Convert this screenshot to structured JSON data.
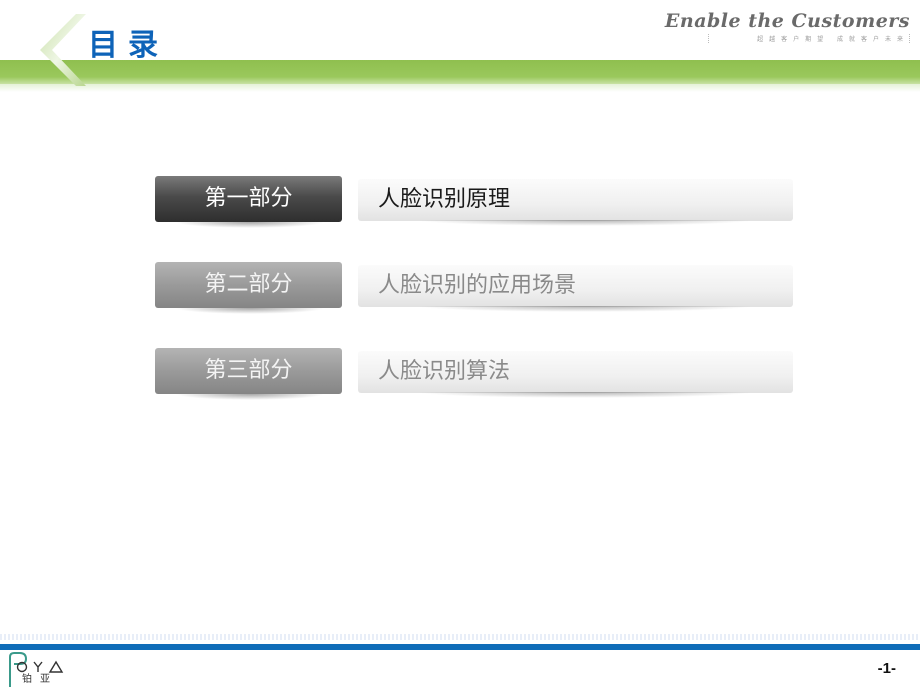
{
  "header": {
    "title": "目录",
    "slogan": "Enable the Customers",
    "slogan_sub": "超越客户期望 成就客户未来"
  },
  "contents": [
    {
      "part": "第一部分",
      "topic": "人脸识别原理",
      "active": true
    },
    {
      "part": "第二部分",
      "topic": "人脸识别的应用场景",
      "active": false
    },
    {
      "part": "第三部分",
      "topic": "人脸识别算法",
      "active": false
    }
  ],
  "footer": {
    "logo_text": "OYA",
    "logo_sub": "铂亚",
    "page_number": "-1-"
  },
  "colors": {
    "accent_green": "#9ac85c",
    "title_blue": "#0e63b8",
    "footer_blue": "#0f6db8"
  }
}
